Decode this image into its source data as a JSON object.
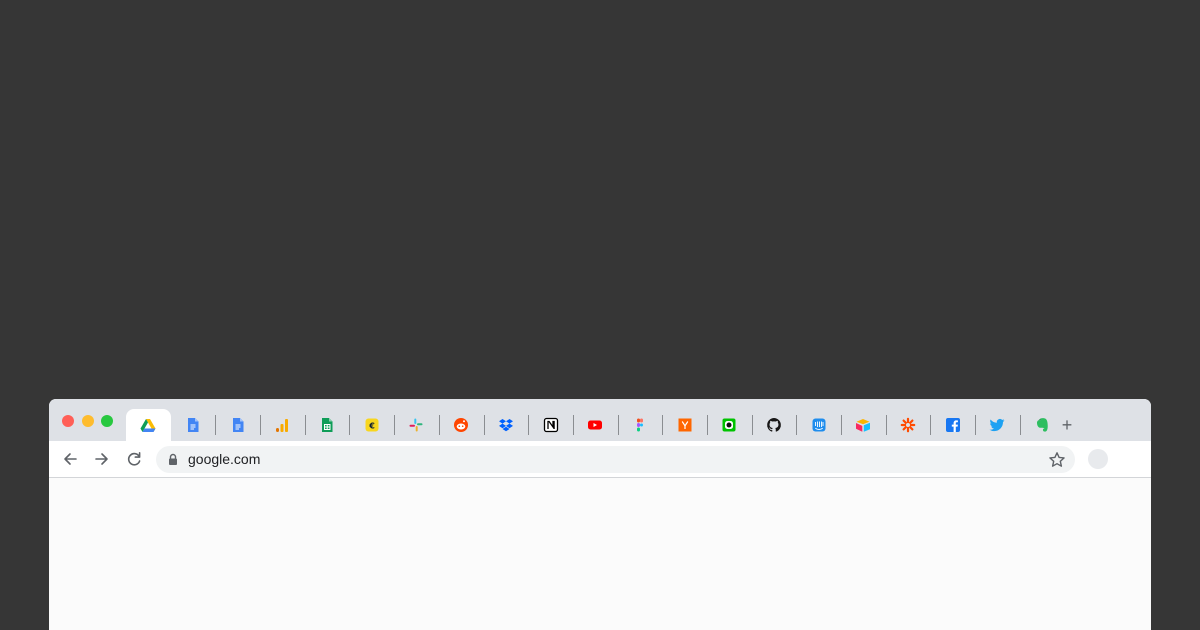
{
  "window": {
    "traffic_lights": {
      "close": "#ff5f57",
      "minimize": "#febc2e",
      "maximize": "#28c840"
    }
  },
  "tabs": [
    {
      "icon": "google-drive-icon",
      "active": true
    },
    {
      "icon": "google-docs-icon",
      "active": false
    },
    {
      "icon": "google-docs-icon",
      "active": false
    },
    {
      "icon": "google-analytics-icon",
      "active": false
    },
    {
      "icon": "google-sheets-icon",
      "active": false
    },
    {
      "icon": "expensify-icon",
      "active": false
    },
    {
      "icon": "slack-icon",
      "active": false
    },
    {
      "icon": "reddit-icon",
      "active": false
    },
    {
      "icon": "dropbox-icon",
      "active": false
    },
    {
      "icon": "notion-icon",
      "active": false
    },
    {
      "icon": "youtube-icon",
      "active": false
    },
    {
      "icon": "figma-icon",
      "active": false
    },
    {
      "icon": "hacker-news-icon",
      "active": false
    },
    {
      "icon": "app-icon",
      "active": false
    },
    {
      "icon": "github-icon",
      "active": false
    },
    {
      "icon": "intercom-icon",
      "active": false
    },
    {
      "icon": "airtable-icon",
      "active": false
    },
    {
      "icon": "zapier-icon",
      "active": false
    },
    {
      "icon": "facebook-icon",
      "active": false
    },
    {
      "icon": "twitter-icon",
      "active": false
    },
    {
      "icon": "evernote-icon",
      "active": false
    }
  ],
  "new_tab_label": "+",
  "toolbar": {
    "back_icon": "back-arrow-icon",
    "forward_icon": "forward-arrow-icon",
    "reload_icon": "reload-icon",
    "address": "google.com",
    "lock_icon": "lock-icon",
    "bookmark_icon": "star-icon"
  },
  "colors": {
    "background": "#363636",
    "tabstrip": "#dee1e6",
    "omnibox": "#f1f3f4"
  }
}
